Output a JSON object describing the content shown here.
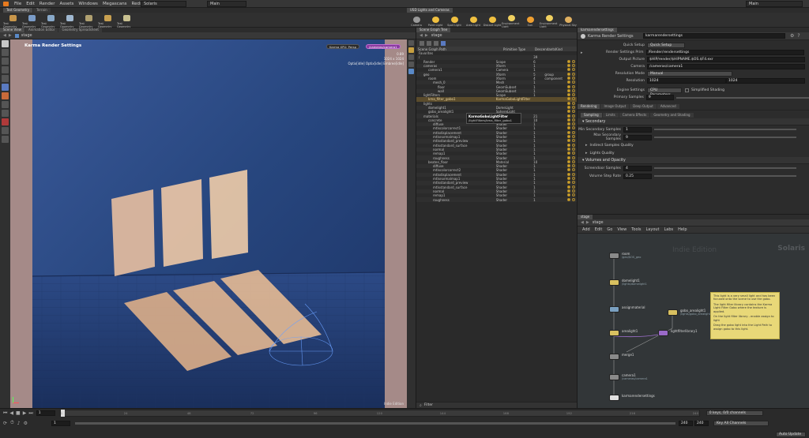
{
  "menu": [
    "File",
    "Edit",
    "Render",
    "Assets",
    "Windows",
    "Megascans",
    "Redshift",
    "Labs",
    "Help"
  ],
  "desktop": "Solaris",
  "main_context": "Main",
  "right_main": "Main",
  "shelf_tabs": [
    "Test Geometry",
    "Terrain"
  ],
  "shelf_tools": [
    {
      "label": "Test Geometry",
      "color": "#c8964a"
    },
    {
      "label": "Test Geometry",
      "color": "#7a9cc8"
    },
    {
      "label": "Test Geometry",
      "color": "#88a8c8"
    },
    {
      "label": "Test Geometry",
      "color": "#a0b8d0"
    },
    {
      "label": "Test Geometry",
      "color": "#b0a070"
    },
    {
      "label": "Test Geometry",
      "color": "#c8a050"
    },
    {
      "label": "Test Geometry",
      "color": "#c8c090"
    }
  ],
  "light_shelf_tabs": [
    "USD Lights and Cameras"
  ],
  "light_tools": [
    "Camera",
    "Point Light",
    "Spot Light",
    "Area Light",
    "Distant Light",
    "Environment Light",
    "Sun",
    "Environment Light",
    "Physical Sky"
  ],
  "viewport": {
    "tabs": [
      "Scene View",
      "Animation Editor",
      "Geometry Spreadsheet"
    ],
    "path": "stage",
    "title": "Karma Render Settings",
    "renderer": "Karma XPU: Persp",
    "camera": "/cameras/camera1",
    "stats1": "1024 x 1024",
    "stats2": "Optix[idle] Optix[idle] Embree[idle]",
    "stats3": "0.89",
    "indie": "Indie Edition"
  },
  "scene_graph": {
    "tabs": [
      "Scene Graph Tree",
      "Scene Graph Details"
    ],
    "path": "stage",
    "columns": [
      "Scene Graph Path",
      "Primitive Type",
      "Descendants",
      "Kind"
    ],
    "rows": [
      {
        "name": "Favorites",
        "type": "",
        "desc": "",
        "kind": "",
        "indent": 0
      },
      {
        "name": "/",
        "type": "",
        "desc": "39",
        "kind": "",
        "indent": 0
      },
      {
        "name": "Render",
        "type": "Scope",
        "desc": "6",
        "kind": "",
        "indent": 1
      },
      {
        "name": "cameras",
        "type": "Xform",
        "desc": "1",
        "kind": "",
        "indent": 1
      },
      {
        "name": "camera1",
        "type": "Camera",
        "desc": "1",
        "kind": "",
        "indent": 2
      },
      {
        "name": "geo",
        "type": "Xform",
        "desc": "5",
        "kind": "group",
        "indent": 1
      },
      {
        "name": "room",
        "type": "Xform",
        "desc": "4",
        "kind": "component",
        "indent": 2
      },
      {
        "name": "mesh_0",
        "type": "Mesh",
        "desc": "1",
        "kind": "",
        "indent": 3
      },
      {
        "name": "floor",
        "type": "GeomSubset",
        "desc": "1",
        "kind": "",
        "indent": 4
      },
      {
        "name": "wall",
        "type": "GeomSubset",
        "desc": "1",
        "kind": "",
        "indent": 4
      },
      {
        "name": "lightFilters",
        "type": "Scope",
        "desc": "1",
        "kind": "",
        "indent": 1
      },
      {
        "name": "kma_filter_gobo1",
        "type": "KarmaGoboLightFilter",
        "desc": "",
        "kind": "",
        "indent": 2,
        "sel": true
      },
      {
        "name": "lights",
        "type": "",
        "desc": "",
        "kind": "",
        "indent": 1
      },
      {
        "name": "domelight1",
        "type": "DomeLight",
        "desc": "",
        "kind": "",
        "indent": 2
      },
      {
        "name": "gobo_arealight1",
        "type": "SphereLight",
        "desc": "",
        "kind": "",
        "indent": 2
      },
      {
        "name": "materials",
        "type": "Scope",
        "desc": "21",
        "kind": "",
        "indent": 1
      },
      {
        "name": "concrete",
        "type": "Material",
        "desc": "10",
        "kind": "",
        "indent": 2
      },
      {
        "name": "diffuse",
        "type": "Shader",
        "desc": "1",
        "kind": "",
        "indent": 3
      },
      {
        "name": "mtlxcolorcorrect1",
        "type": "Shader",
        "desc": "1",
        "kind": "",
        "indent": 3
      },
      {
        "name": "mtlxdisplacement",
        "type": "Shader",
        "desc": "1",
        "kind": "",
        "indent": 3
      },
      {
        "name": "mtlxnormalmap1",
        "type": "Shader",
        "desc": "1",
        "kind": "",
        "indent": 3
      },
      {
        "name": "mtlxstandard_preview",
        "type": "Shader",
        "desc": "1",
        "kind": "",
        "indent": 3
      },
      {
        "name": "mtlxstandard_surface",
        "type": "Shader",
        "desc": "1",
        "kind": "",
        "indent": 3
      },
      {
        "name": "normal",
        "type": "Shader",
        "desc": "1",
        "kind": "",
        "indent": 3
      },
      {
        "name": "remap1",
        "type": "Shader",
        "desc": "1",
        "kind": "",
        "indent": 3
      },
      {
        "name": "roughness",
        "type": "Shader",
        "desc": "1",
        "kind": "",
        "indent": 3
      },
      {
        "name": "beaten_floor",
        "type": "Material",
        "desc": "10",
        "kind": "",
        "indent": 2
      },
      {
        "name": "diffuse",
        "type": "Shader",
        "desc": "1",
        "kind": "",
        "indent": 3
      },
      {
        "name": "mtlxcolorcorrect2",
        "type": "Shader",
        "desc": "1",
        "kind": "",
        "indent": 3
      },
      {
        "name": "mtlxdisplacement",
        "type": "Shader",
        "desc": "1",
        "kind": "",
        "indent": 3
      },
      {
        "name": "mtlxnormalmap1",
        "type": "Shader",
        "desc": "1",
        "kind": "",
        "indent": 3
      },
      {
        "name": "mtlxstandard_preview",
        "type": "Shader",
        "desc": "1",
        "kind": "",
        "indent": 3
      },
      {
        "name": "mtlxstandard_surface",
        "type": "Shader",
        "desc": "1",
        "kind": "",
        "indent": 3
      },
      {
        "name": "normal",
        "type": "Shader",
        "desc": "1",
        "kind": "",
        "indent": 3
      },
      {
        "name": "remap1",
        "type": "Shader",
        "desc": "1",
        "kind": "",
        "indent": 3
      },
      {
        "name": "roughness",
        "type": "Shader",
        "desc": "1",
        "kind": "",
        "indent": 3
      }
    ],
    "tooltip_title": "KarmaGoboLightFilter",
    "tooltip_path": "/lightFilters/kma_filter_gobo1",
    "filter_label": "Filter"
  },
  "params": {
    "tab": "karmarendersettings",
    "node_type": "Karma Render Settings",
    "node_name": "karmarendersettings",
    "quick_setup_label": "Quick Setup",
    "quick_setup_value": "Quick Setup",
    "section_header": "Render Settings Prim",
    "render_prim": "/Render/rendersettings",
    "output_picture_label": "Output Picture",
    "output_picture": "$HIP/render/$HIPNAME.$OS.$F4.exr",
    "camera_label": "Camera",
    "camera": "/cameras/camera1",
    "res_mode_label": "Resolution Mode",
    "res_mode": "Manual",
    "resolution_label": "Resolution",
    "res_x": "1024",
    "res_y": "1024",
    "engine_label": "Engine Settings",
    "engine": "CPU Parameters",
    "simplified_label": "Simplified Shading",
    "primary_label": "Primary Samples",
    "primary": "9",
    "main_tabs": [
      "Rendering",
      "Image Output",
      "Deep Output",
      "Advanced"
    ],
    "sub_tabs": [
      "Sampling",
      "Limits",
      "Camera Effects",
      "Geometry and Shading"
    ],
    "secondary_section": "Secondary",
    "min_secondary_label": "Min Secondary Samples",
    "min_secondary": "1",
    "max_secondary_label": "Max Secondary Samples",
    "max_secondary": "9",
    "indirect_quality": "Indirect Samples Quality",
    "lights_quality": "Lights Quality",
    "volumes_section": "Volumes and Opacity",
    "screendoor_label": "Screendoor Samples",
    "screendoor": "4",
    "volume_step_label": "Volume Step Rate",
    "volume_step": "0.25"
  },
  "network": {
    "tab": "stage",
    "path": "stage",
    "menu": [
      "Add",
      "Edit",
      "Go",
      "View",
      "Tools",
      "Layout",
      "Labs",
      "Help"
    ],
    "watermark": "Indie Edition",
    "context": "Solaris",
    "nodes": [
      {
        "name": "room",
        "sub": "/geo/$OS_geo",
        "color": "#8a8a8a"
      },
      {
        "name": "domelight1",
        "sub": "/lights/domelight1",
        "color": "#d8c060"
      },
      {
        "name": "assignmaterial",
        "sub": "",
        "color": "#7aa0c0"
      },
      {
        "name": "arealight1",
        "sub": "",
        "color": "#d8c060"
      },
      {
        "name": "gobo_arealight1",
        "sub": "/lights/gobo_arealight1",
        "color": "#d8c060"
      },
      {
        "name": "lightfilterlibrary1",
        "sub": "",
        "color": "#9a6ac8"
      },
      {
        "name": "merge1",
        "sub": "",
        "color": "#8a8a8a"
      },
      {
        "name": "camera1",
        "sub": "/cameras/camera1",
        "color": "#8a8a8a"
      },
      {
        "name": "karmarendersettings",
        "sub": "",
        "color": "#e0e0e0"
      }
    ],
    "sticky": [
      "This light is a very small light and has been focused onto the scene to use the gobo.",
      "The light filter library contains the Karma Light Filter Gobo where the texture is applied.",
      "On the light filter library - enable assign to light",
      "Drag the gobo light into the Light Path to assign gobo to this light."
    ]
  },
  "timeline": {
    "frame": "1",
    "start": "1",
    "end": "240",
    "end2": "240",
    "ticks": [
      "1",
      "24",
      "48",
      "72",
      "96",
      "120",
      "144",
      "168",
      "192",
      "216",
      "240"
    ],
    "keys": "0 keys, 0/0 channels",
    "key_all": "Key All Channels",
    "auto_update": "Auto Update"
  }
}
